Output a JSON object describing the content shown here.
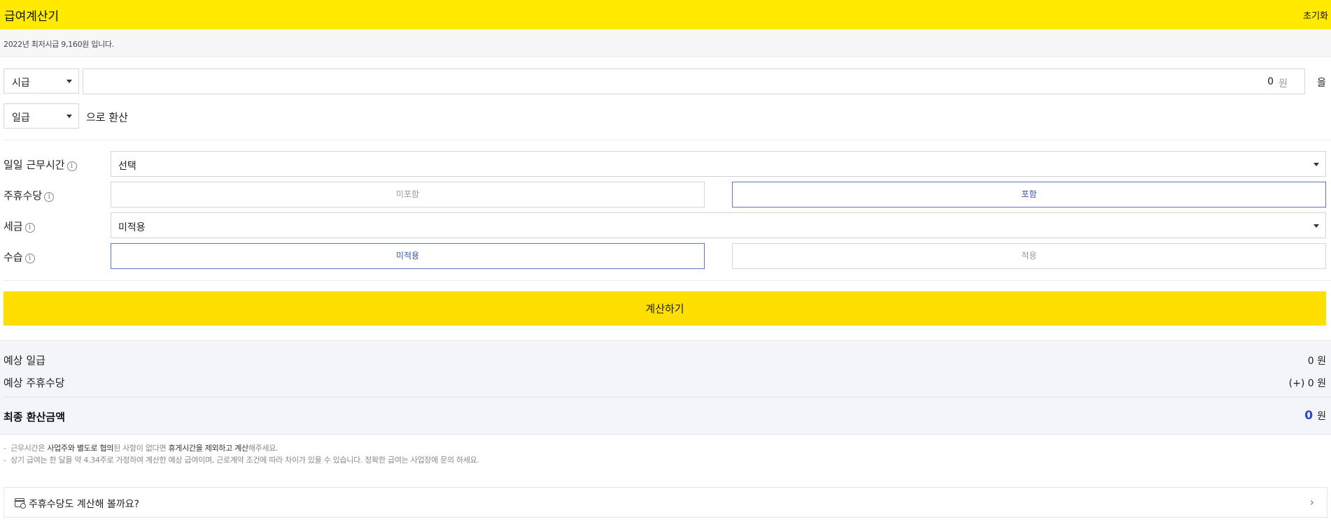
{
  "header": {
    "title": "급여계산기",
    "reset_label": "초기화"
  },
  "notice": {
    "text": "2022년 최저시급 9,160원 입니다."
  },
  "converter": {
    "from_unit": "시급",
    "amount_value": "0",
    "amount_unit": "원",
    "josa": "을",
    "to_unit": "일급",
    "convert_text": "으로 환산"
  },
  "options": {
    "work_hours": {
      "label": "일일 근무시간",
      "value": "선택"
    },
    "weekly_allowance": {
      "label": "주휴수당",
      "options": [
        "미포함",
        "포함"
      ],
      "selected": "포함"
    },
    "tax": {
      "label": "세금",
      "value": "미적용"
    },
    "probation": {
      "label": "수습",
      "options": [
        "미적용",
        "적용"
      ],
      "selected": "미적용"
    },
    "info_glyph": "i"
  },
  "calc_button": "계산하기",
  "result": {
    "daily_label": "예상 일급",
    "daily_value": "0 원",
    "weekly_label": "예상 주휴수당",
    "weekly_value": "(+) 0 원",
    "final_label": "최종 환산금액",
    "final_value": "0",
    "final_unit": "원",
    "accent_color": "#2a48c8"
  },
  "notes": {
    "line1_parts": [
      "근무시간은 ",
      "사업주와 별도로 협의",
      "된 사항이 없다면 ",
      "휴게시간을 제외하고 계산",
      "해주세요."
    ],
    "line2": "상기 급여는 한 달을 약 4.34주로 가정하여 계산한 예상 급여이며, 근로계약 조건에 따라 차이가 있을 수 있습니다. 정확한 급여는 사업장에 문의 하세요."
  },
  "link_card": {
    "label": "주휴수당도 계산해 볼까요?",
    "icon": "calendar-icon"
  },
  "colors": {
    "header": "#ffea00",
    "button": "#ffdf00",
    "active_border": "#5b78c8"
  }
}
